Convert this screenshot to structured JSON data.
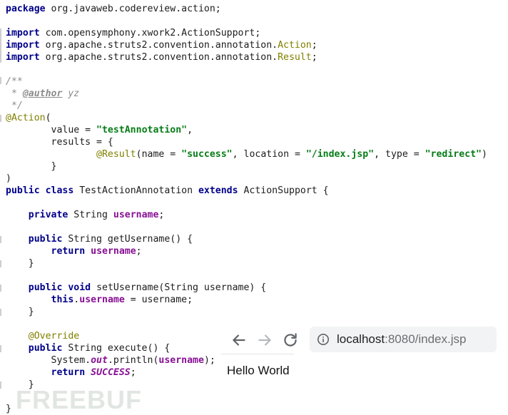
{
  "code": {
    "package_kw": "package",
    "package_name": " org.javaweb.codereview.action;",
    "import_kw": "import",
    "import1": " com.opensymphony.xwork2.ActionSupport;",
    "import2_prefix": " org.apache.struts2.convention.annotation.",
    "import2_cls": "Action",
    "import3_prefix": " org.apache.struts2.convention.annotation.",
    "import3_cls": "Result",
    "semicolon": ";",
    "doc_open": "/**",
    "doc_star": " * ",
    "doc_author_tag": "@author",
    "doc_author_val": " yz",
    "doc_close": " */",
    "action_ann": "@Action",
    "paren_open": "(",
    "value_key": "        value = ",
    "value_str": "\"testAnnotation\"",
    "comma": ",",
    "results_line": "        results = {",
    "result_indent": "                ",
    "result_ann": "@Result",
    "result_name_key": "(name = ",
    "result_name_val": "\"success\"",
    "result_loc_key": ", location = ",
    "result_loc_val": "\"/index.jsp\"",
    "result_type_key": ", type = ",
    "result_type_val": "\"redirect\"",
    "paren_close": ")",
    "results_close": "        }",
    "class_public": "public",
    "class_kw": "class",
    "class_name": " TestActionAnnotation ",
    "extends_kw": "extends",
    "class_super": " ActionSupport {",
    "private_kw": "private",
    "field_type": " String ",
    "field_name": "username",
    "getter_sig": " String getUsername() {",
    "return_kw": "return",
    "void_kw": "void",
    "setter_sig": " setUsername(String username) {",
    "this_kw": "this",
    "dot": ".",
    "assign_rhs": " = username;",
    "close_brace": "}",
    "override_ann": "@Override",
    "execute_sig": " String execute() {",
    "println_pre": "System.",
    "println_out": "out",
    "println_mid": ".println(",
    "println_end": ");",
    "success_const": "SUCCESS"
  },
  "browser": {
    "url_host": "localhost",
    "url_rest": ":8080/index.jsp",
    "page_text": "Hello World"
  },
  "watermark": "FREEBUF"
}
